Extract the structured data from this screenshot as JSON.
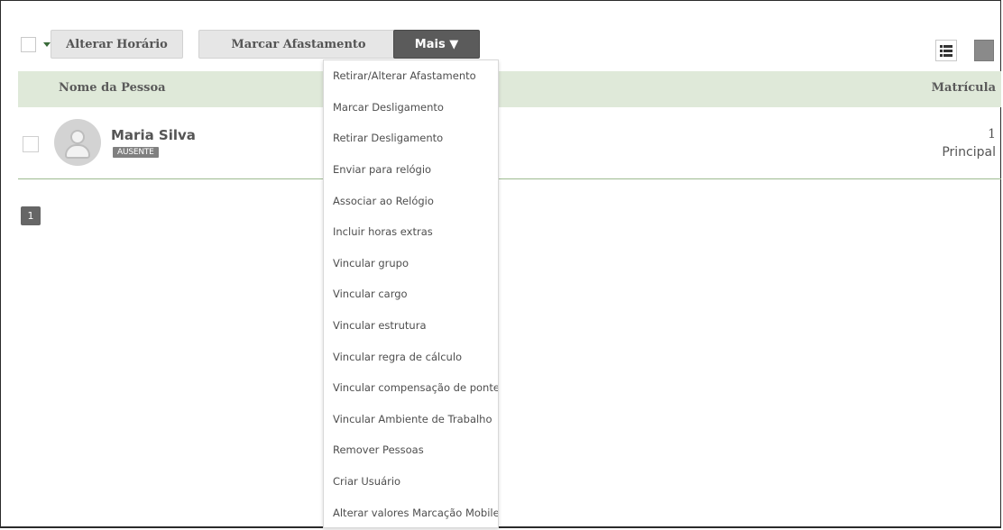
{
  "toolbar": {
    "alterar_horario_label": "Alterar Horário",
    "marcar_afastamento_label": "Marcar Afastamento",
    "mais_label": "Mais ▼"
  },
  "table": {
    "headers": {
      "name": "Nome da Pessoa",
      "matricula": "Matrícula"
    },
    "rows": [
      {
        "name": "Maria Silva",
        "status": "AUSENTE",
        "matricula_number": "1",
        "matricula_label": "Principal"
      }
    ]
  },
  "pagination": {
    "current_page": "1"
  },
  "dropdown": {
    "items": [
      "Retirar/Alterar Afastamento",
      "Marcar Desligamento",
      "Retirar Desligamento",
      "Enviar para relógio",
      "Associar ao Relógio",
      "Incluir horas extras",
      "Vincular grupo",
      "Vincular cargo",
      "Vincular estrutura",
      "Vincular regra de cálculo",
      "Vincular compensação de ponte",
      "Vincular Ambiente de Trabalho",
      "Remover Pessoas",
      "Criar Usuário",
      "Alterar valores Marcação Mobile"
    ]
  },
  "icons": {
    "list_view": "list-view-icon",
    "grid_view": "grid-view-icon",
    "avatar": "person-icon"
  },
  "colors": {
    "header_bg": "#dfe9d9",
    "mais_button": "#5b5b5b",
    "status_badge": "#808080"
  }
}
